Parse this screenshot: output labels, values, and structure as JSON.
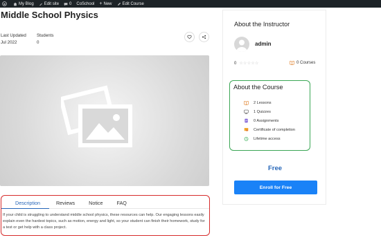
{
  "adminbar": {
    "items": [
      "My Blog",
      "Edit site",
      "0",
      "CoSchool",
      "New",
      "Edit Course"
    ]
  },
  "course": {
    "title": "Middle School Physics",
    "last_updated_label": "Last Updated",
    "last_updated_value": "Jul 2022",
    "students_label": "Students",
    "students_value": "0"
  },
  "tabs": [
    "Description",
    "Reviews",
    "Notice",
    "FAQ"
  ],
  "description": "If your child is struggling to understand middle school physics, these resources can help. Our engaging lessons easily explain even the hardest topics, such as motion, energy and light, so your student can finish their homework, study for a test or get help with a class project.",
  "instructor": {
    "heading": "About the Instructor",
    "name": "admin",
    "rating": "0",
    "stars": "☆☆☆☆☆",
    "courses": "0 Courses"
  },
  "about_course": {
    "heading": "About the Course",
    "items": [
      {
        "icon": "book-icon",
        "label": "2 Lessons"
      },
      {
        "icon": "quiz-icon",
        "label": "1 Quizzes"
      },
      {
        "icon": "assignment-icon",
        "label": "0 Assignments"
      },
      {
        "icon": "certificate-icon",
        "label": "Certificate of completion"
      },
      {
        "icon": "clock-icon",
        "label": "Lifetime access"
      }
    ]
  },
  "pricing": {
    "price": "Free",
    "enroll_label": "Enroll for Free"
  },
  "colors": {
    "accent": "#1a82f7",
    "price": "#2565b8",
    "highlight_red": "#d62b2b",
    "highlight_green": "#3aa654"
  }
}
